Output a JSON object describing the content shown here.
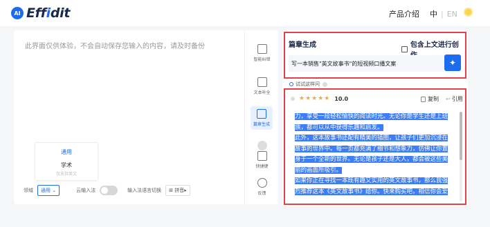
{
  "app": {
    "logo_badge": "AI",
    "logo_text_part1": "Eff",
    "logo_text_part2": "i",
    "logo_text_part3": "dit",
    "brand_color": "#1d6cf0"
  },
  "header": {
    "product_intro": "产品介绍",
    "lang_zh": "中",
    "lang_sep": "|",
    "lang_en": "EN"
  },
  "editor": {
    "placeholder": "此界面仅供体验，不会自动保存您输入的内容，请及时备份",
    "mode_card": {
      "title": "通用",
      "name": "学术",
      "desc": "仅支持英文"
    },
    "bottom": {
      "domain_label": "领域",
      "domain_value": "通用",
      "cloud_ime_label": "云输入法",
      "ime_switch_label": "输入法语言切换",
      "pinyin_label": "拼音"
    }
  },
  "tools": [
    {
      "label": "智能纠错",
      "icon": "scan-icon"
    },
    {
      "label": "文本补全",
      "icon": "document-icon"
    },
    {
      "label": "篇章生成",
      "icon": "article-icon"
    },
    {
      "label": "快捷键",
      "icon": "keyboard-icon"
    },
    {
      "label": "反馈",
      "icon": "question-icon"
    }
  ],
  "generation": {
    "title": "篇章生成",
    "include_context_label": "包含上文进行创作",
    "prompt_value": "写一本销售\"英文故事书\"的短视频口播文案",
    "try_label": "试试这样问"
  },
  "result": {
    "stars": "★★★★★",
    "score": "10.0",
    "copy_label": "复制",
    "quote_label": "引用",
    "lines": [
      "力，享受一段轻松愉快的阅读时光。无论你是学生还是上班",
      "族，都可以从中获得乐趣和启发。",
      "此外，这本故事书还配有精美的插图，让孩子们更加沉浸在",
      "故事的世界中。每一页都充满了细节和想象力，仿佛让你置",
      "身于一个全新的世界。无论是孩子还是大人，都会被这些美",
      "丽的画面所吸引。",
      "如果你正在寻找一本既有趣又实用的英文故事书，那么我强",
      "烈推荐这本《英文故事书》给你。快来购买吧，相信你会爱"
    ]
  }
}
